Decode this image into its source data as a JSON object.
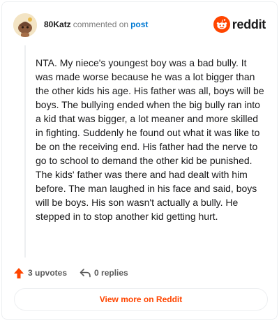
{
  "header": {
    "username": "80Katz",
    "commented_on": "commented on",
    "post_link": "post"
  },
  "brand": {
    "logo_text": "reddit",
    "logo_icon": "reddit-alien-icon",
    "accent_color": "#ff4500"
  },
  "comment": {
    "text": "NTA. My niece's youngest boy was a bad bully. It was made worse because he was a lot bigger than the other kids his age. His father was all, boys will be boys. The bullying ended when the big bully ran into a kid that was bigger, a lot meaner and more skilled in fighting. Suddenly he found out what it was like to be on the receiving end. His father had the nerve to go to school to demand the other kid be punished. The kids' father was there and had dealt with him before. The man laughed in his face and said, boys will be boys. His son wasn't actually a bully. He stepped in to stop another kid getting hurt."
  },
  "actions": {
    "upvotes": "3 upvotes",
    "upvote_icon": "upvote-arrow-icon",
    "replies": "0 replies",
    "reply_icon": "reply-arrow-icon"
  },
  "footer": {
    "view_more": "View more on Reddit"
  }
}
